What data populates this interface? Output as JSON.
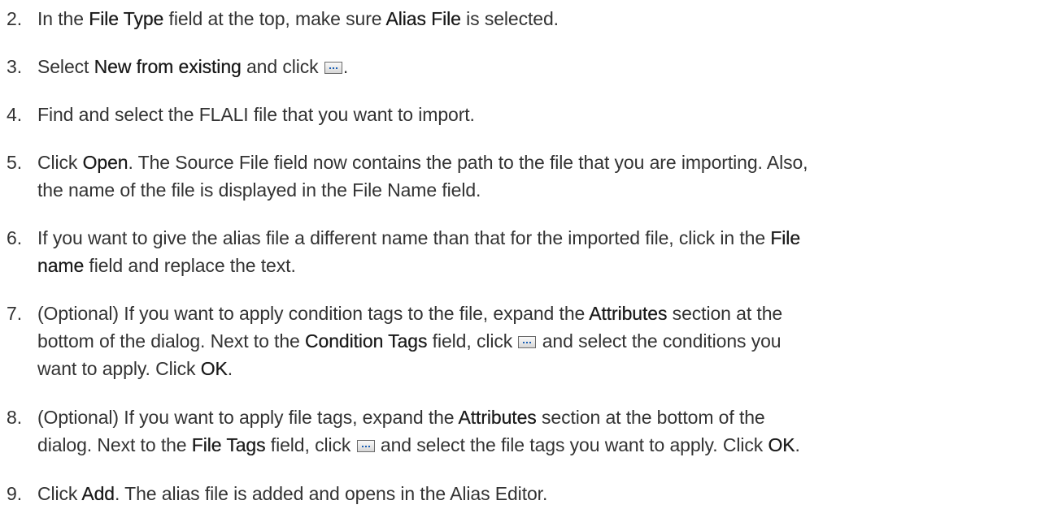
{
  "steps": [
    {
      "num": "2.",
      "parts": [
        "In the ",
        "File Type",
        " field at the top, make sure ",
        "Alias File",
        " is selected."
      ]
    },
    {
      "num": "3.",
      "parts": [
        "Select ",
        "New from existing",
        " and click ",
        "."
      ]
    },
    {
      "num": "4.",
      "parts": [
        "Find and select the FLALI file that you want to import."
      ]
    },
    {
      "num": "5.",
      "parts": [
        "Click ",
        "Open",
        ". The Source File field now contains the path to the file that you are importing. Also,",
        "the name of the file is displayed in the File Name field."
      ]
    },
    {
      "num": "6.",
      "parts": [
        "If you want to give the alias file a different name than that for the imported file, click in the ",
        "File",
        "name",
        " field and replace the text."
      ]
    },
    {
      "num": "7.",
      "parts": [
        "(Optional) If you want to apply condition tags to the file, expand the ",
        "Attributes",
        " section at the",
        "bottom of the dialog. Next to the ",
        "Condition Tags",
        " field, click ",
        " and select the conditions you",
        "want to apply. Click ",
        "OK",
        "."
      ]
    },
    {
      "num": "8.",
      "parts": [
        "(Optional) If you want to apply file tags, expand the ",
        "Attributes",
        " section at the bottom of the",
        "dialog. Next to the ",
        "File Tags",
        " field, click ",
        " and select the file tags you want to apply. Click ",
        "OK",
        "."
      ]
    },
    {
      "num": "9.",
      "parts": [
        "Click ",
        "Add",
        ". The alias file is added and opens in the Alias Editor."
      ]
    }
  ],
  "icons": {
    "browse_button": "ellipsis-button-icon"
  }
}
